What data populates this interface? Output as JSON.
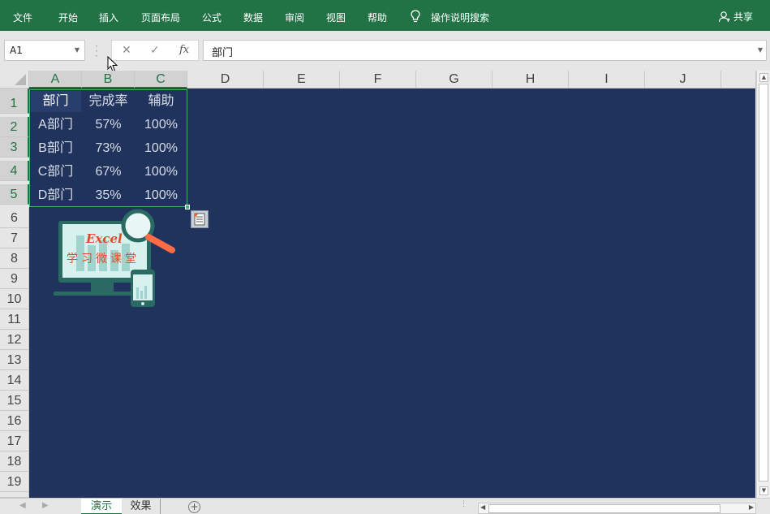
{
  "ribbon": {
    "tabs": [
      "文件",
      "开始",
      "插入",
      "页面布局",
      "公式",
      "数据",
      "审阅",
      "视图",
      "帮助"
    ],
    "search_label": "操作说明搜索",
    "share_label": "共享"
  },
  "formula_bar": {
    "name_box": "A1",
    "cancel_symbol": "✕",
    "enter_symbol": "✓",
    "fx_symbol": "fx",
    "content": "部门"
  },
  "grid": {
    "columns": [
      "A",
      "B",
      "C",
      "D",
      "E",
      "F",
      "G",
      "H",
      "I",
      "J"
    ],
    "rows": [
      "1",
      "2",
      "3",
      "4",
      "5",
      "6",
      "7",
      "8",
      "9",
      "10",
      "11",
      "12",
      "13",
      "14",
      "15",
      "16",
      "17",
      "18",
      "19"
    ],
    "table": [
      [
        "部门",
        "完成率",
        "辅助"
      ],
      [
        "A部门",
        "57%",
        "100%"
      ],
      [
        "B部门",
        "73%",
        "100%"
      ],
      [
        "C部门",
        "67%",
        "100%"
      ],
      [
        "D部门",
        "35%",
        "100%"
      ]
    ],
    "sheet_background": "#20335d",
    "selection_color": "#4caf74"
  },
  "logo": {
    "title": "Excel",
    "subtitle": "学习微课堂"
  },
  "sheets": {
    "tabs": [
      "演示",
      "效果"
    ],
    "active": "演示"
  },
  "colors": {
    "ribbon": "#217346",
    "accent": "#217346"
  }
}
